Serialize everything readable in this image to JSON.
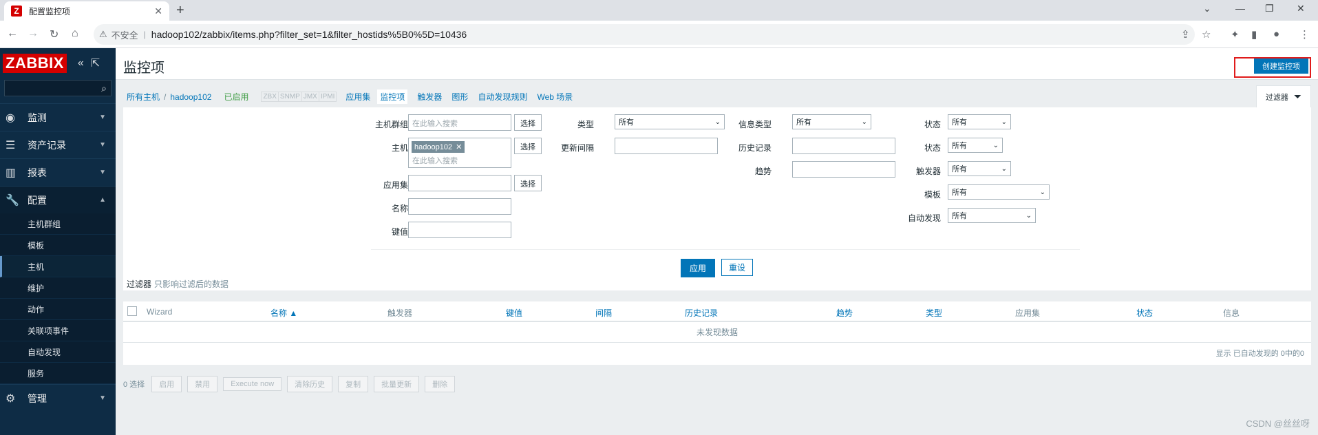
{
  "browser": {
    "tab_title": "配置监控项",
    "favicon_letter": "Z",
    "tab_close": "✕",
    "new_tab": "+",
    "insecure_label": "不安全",
    "url": "hadoop102/zabbix/items.php?filter_set=1&filter_hostids%5B0%5D=10436"
  },
  "sidebar": {
    "logo": "ZABBIX",
    "menu": [
      {
        "label": "监测",
        "icon": "eye-icon"
      },
      {
        "label": "资产记录",
        "icon": "list-icon"
      },
      {
        "label": "报表",
        "icon": "chart-icon"
      },
      {
        "label": "配置",
        "icon": "wrench-icon"
      },
      {
        "label": "管理",
        "icon": "gear-icon"
      }
    ],
    "submenu": [
      "主机群组",
      "模板",
      "主机",
      "维护",
      "动作",
      "关联项事件",
      "自动发现",
      "服务"
    ]
  },
  "header": {
    "title": "监控项",
    "create_button": "创建监控项"
  },
  "breadcrumb": {
    "all_hosts": "所有主机",
    "separator": "/",
    "host": "hadoop102",
    "status": "已启用",
    "protocols": [
      "ZBX",
      "SNMP",
      "JMX",
      "IPMI"
    ],
    "tabs": [
      "应用集",
      "监控项",
      "触发器",
      "图形",
      "自动发现规则",
      "Web 场景"
    ]
  },
  "filter_tab": {
    "label": "过滤器"
  },
  "filter": {
    "host_group_label": "主机群组",
    "host_group_placeholder": "在此输入搜索",
    "select_button": "选择",
    "host_label": "主机",
    "host_tag": "hadoop102",
    "host_placeholder": "在此输入搜索",
    "app_label": "应用集",
    "name_label": "名称",
    "key_label": "键值",
    "type_label": "类型",
    "type_value": "所有",
    "interval_label": "更新间隔",
    "info_type_label": "信息类型",
    "info_type_value": "所有",
    "history_label": "历史记录",
    "trend_label": "趋势",
    "state_label": "状态",
    "state_value": "所有",
    "status_label": "状态",
    "status_value": "所有",
    "triggers_label": "触发器",
    "triggers_value": "所有",
    "template_label": "模板",
    "template_value": "所有",
    "discovery_label": "自动发现",
    "discovery_value": "所有",
    "apply": "应用",
    "reset": "重设"
  },
  "filter_note": {
    "label": "过滤器",
    "text": "只影响过滤后的数据"
  },
  "table": {
    "columns": [
      "Wizard",
      "名称 ▲",
      "触发器",
      "键值",
      "间隔",
      "历史记录",
      "趋势",
      "类型",
      "应用集",
      "状态",
      "信息"
    ],
    "empty": "未发现数据",
    "footer": "显示 已自动发现的 0中的0"
  },
  "actions": {
    "selected": "0 选择",
    "buttons": [
      "启用",
      "禁用",
      "Execute now",
      "清除历史",
      "复制",
      "批量更新",
      "删除"
    ]
  },
  "watermark": "CSDN @丝丝呀"
}
